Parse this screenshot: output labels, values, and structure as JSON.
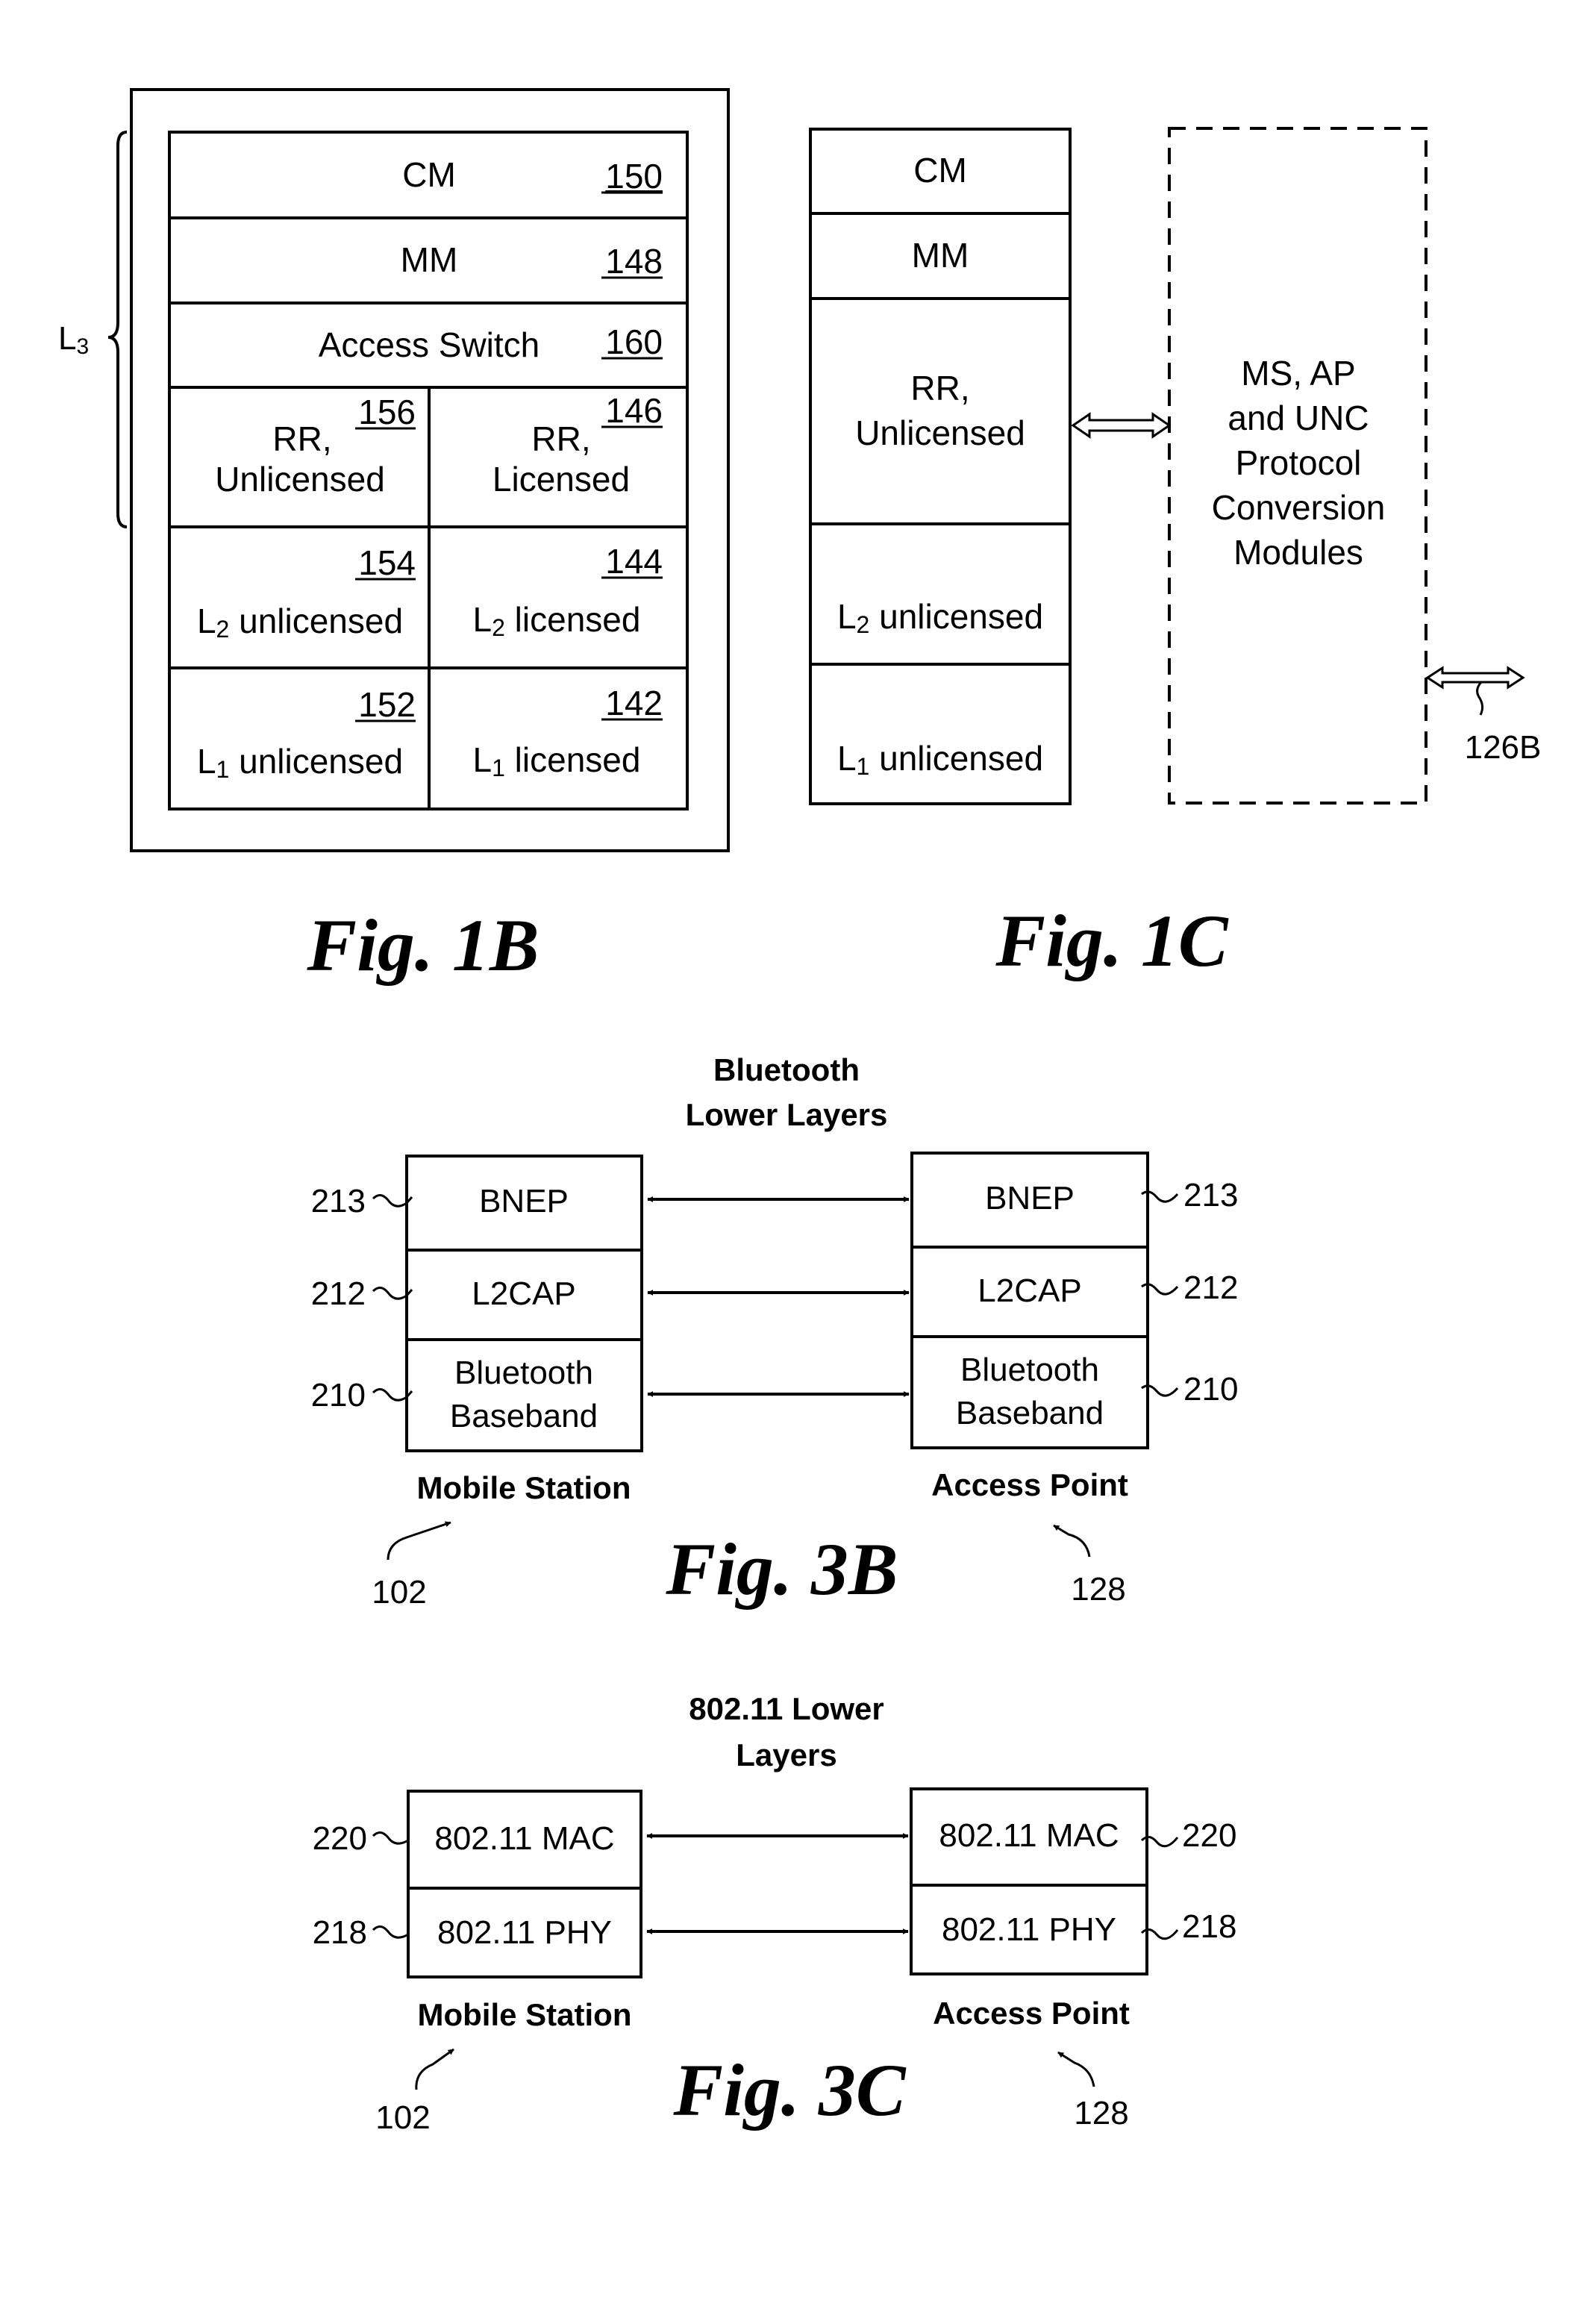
{
  "fig1b": {
    "caption": "Fig. 1B",
    "brace_label": "L",
    "brace_label_sub": "3",
    "rows": {
      "cm": {
        "label": "CM",
        "ref": "150"
      },
      "mm": {
        "label": "MM",
        "ref": "148"
      },
      "access_switch": {
        "label": "Access Switch",
        "ref": "160"
      },
      "rr_unlicensed": {
        "line1": "RR,",
        "line2": "Unlicensed",
        "ref": "156"
      },
      "rr_licensed": {
        "line1": "RR,",
        "line2": "Licensed",
        "ref": "146"
      },
      "l2_unlicensed": {
        "prefix": "L",
        "sub": "2",
        "label": " unlicensed",
        "ref": "154"
      },
      "l2_licensed": {
        "prefix": "L",
        "sub": "2",
        "label": " licensed",
        "ref": "144"
      },
      "l1_unlicensed": {
        "prefix": "L",
        "sub": "1",
        "label": " unlicensed",
        "ref": "152"
      },
      "l1_licensed": {
        "prefix": "L",
        "sub": "1",
        "label": " licensed",
        "ref": "142"
      }
    }
  },
  "fig1c": {
    "caption": "Fig. 1C",
    "stack": {
      "cm": "CM",
      "mm": "MM",
      "rr_line1": "RR,",
      "rr_line2": "Unlicensed",
      "l2": {
        "prefix": "L",
        "sub": "2",
        "label": " unlicensed"
      },
      "l1": {
        "prefix": "L",
        "sub": "1",
        "label": " unlicensed"
      }
    },
    "conversion_box": [
      "MS, AP",
      "and UNC",
      "Protocol",
      "Conversion",
      "Modules"
    ],
    "interface_ref": "126B"
  },
  "fig3b": {
    "caption": "Fig. 3B",
    "title_line1": "Bluetooth",
    "title_line2": "Lower Layers",
    "left": {
      "name": "Mobile Station",
      "ref": "102",
      "layers": [
        {
          "label": "BNEP",
          "ref": "213"
        },
        {
          "label": "L2CAP",
          "ref": "212"
        },
        {
          "line1": "Bluetooth",
          "line2": "Baseband",
          "ref": "210"
        }
      ]
    },
    "right": {
      "name": "Access Point",
      "ref": "128",
      "layers": [
        {
          "label": "BNEP",
          "ref": "213"
        },
        {
          "label": "L2CAP",
          "ref": "212"
        },
        {
          "line1": "Bluetooth",
          "line2": "Baseband",
          "ref": "210"
        }
      ]
    }
  },
  "fig3c": {
    "caption": "Fig. 3C",
    "title_line1": "802.11 Lower",
    "title_line2": "Layers",
    "left": {
      "name": "Mobile Station",
      "ref": "102",
      "layers": [
        {
          "label": "802.11 MAC",
          "ref": "220"
        },
        {
          "label": "802.11 PHY",
          "ref": "218"
        }
      ]
    },
    "right": {
      "name": "Access Point",
      "ref": "128",
      "layers": [
        {
          "label": "802.11 MAC",
          "ref": "220"
        },
        {
          "label": "802.11 PHY",
          "ref": "218"
        }
      ]
    }
  }
}
